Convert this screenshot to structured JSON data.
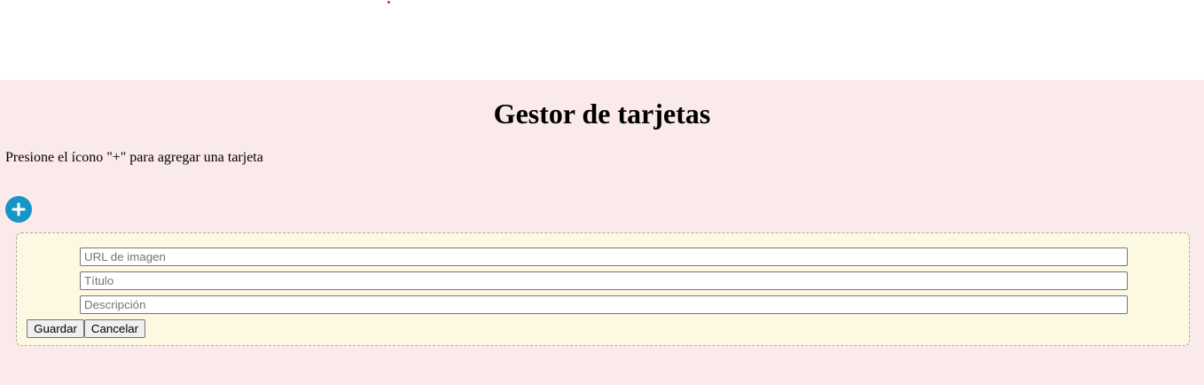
{
  "header": {
    "title": "Gestor de tarjetas",
    "instructions": "Presione el ícono \"+\" para agregar una tarjeta"
  },
  "add_button": {
    "icon": "plus-icon",
    "color": "#1596c8"
  },
  "form": {
    "image_url_placeholder": "URL de imagen",
    "title_placeholder": "Título",
    "description_placeholder": "Descripción",
    "save_label": "Guardar",
    "cancel_label": "Cancelar"
  },
  "colors": {
    "panel_background": "#fbeaea",
    "form_background": "#fdf8e2",
    "accent": "#1596c8"
  }
}
